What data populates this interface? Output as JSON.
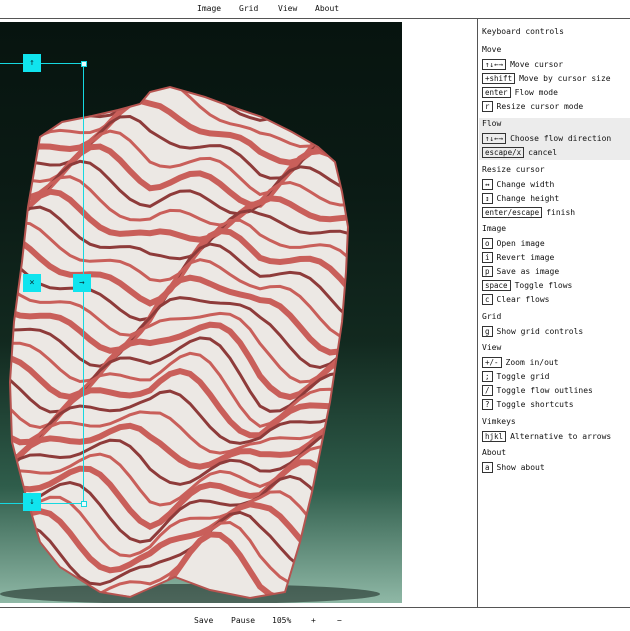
{
  "menu": [
    "Image",
    "Grid",
    "View",
    "About"
  ],
  "bottom": {
    "save": "Save",
    "pause": "Pause",
    "zoom": "105%",
    "plus": "+",
    "minus": "−"
  },
  "cursor_buttons": {
    "up": "↑",
    "close": "×",
    "right": "→",
    "down": "↓"
  },
  "colors": {
    "accent": "#10e4ee",
    "rock_red": "#c95f5a",
    "rock_white": "#ece8e4"
  },
  "panel": {
    "title": "Keyboard controls",
    "sections": {
      "move": {
        "heading": "Move",
        "rows": [
          {
            "key": "↑↓←→",
            "desc": "Move cursor"
          },
          {
            "key": "+shift",
            "desc": "Move by cursor size"
          },
          {
            "key": "enter",
            "desc": "Flow mode"
          },
          {
            "key": "r",
            "desc": "Resize cursor mode"
          }
        ]
      },
      "flow": {
        "heading": "Flow",
        "rows": [
          {
            "key": "↑↓←→",
            "desc": "Choose flow direction"
          },
          {
            "key": "escape/x",
            "desc": "cancel"
          }
        ]
      },
      "resize": {
        "heading": "Resize cursor",
        "rows": [
          {
            "key": "↔",
            "desc": "Change width"
          },
          {
            "key": "↕",
            "desc": "Change height"
          },
          {
            "key": "enter/escape",
            "desc": "finish"
          }
        ]
      },
      "image": {
        "heading": "Image",
        "rows": [
          {
            "key": "o",
            "desc": "Open image"
          },
          {
            "key": "i",
            "desc": "Revert image"
          },
          {
            "key": "p",
            "desc": "Save as image"
          },
          {
            "key": "space",
            "desc": "Toggle flows"
          },
          {
            "key": "c",
            "desc": "Clear flows"
          }
        ]
      },
      "grid": {
        "heading": "Grid",
        "rows": [
          {
            "key": "g",
            "desc": "Show grid controls"
          }
        ]
      },
      "view": {
        "heading": "View",
        "rows": [
          {
            "key": "+/-",
            "desc": "Zoom in/out"
          },
          {
            "key": ";",
            "desc": "Toggle grid"
          },
          {
            "key": "/",
            "desc": "Toggle flow outlines"
          },
          {
            "key": "?",
            "desc": "Toggle shortcuts"
          }
        ]
      },
      "vimkeys": {
        "heading": "Vimkeys",
        "rows": [
          {
            "key": "hjkl",
            "desc": "Alternative to arrows"
          }
        ]
      },
      "about": {
        "heading": "About",
        "rows": [
          {
            "key": "a",
            "desc": "Show about"
          }
        ]
      }
    }
  }
}
